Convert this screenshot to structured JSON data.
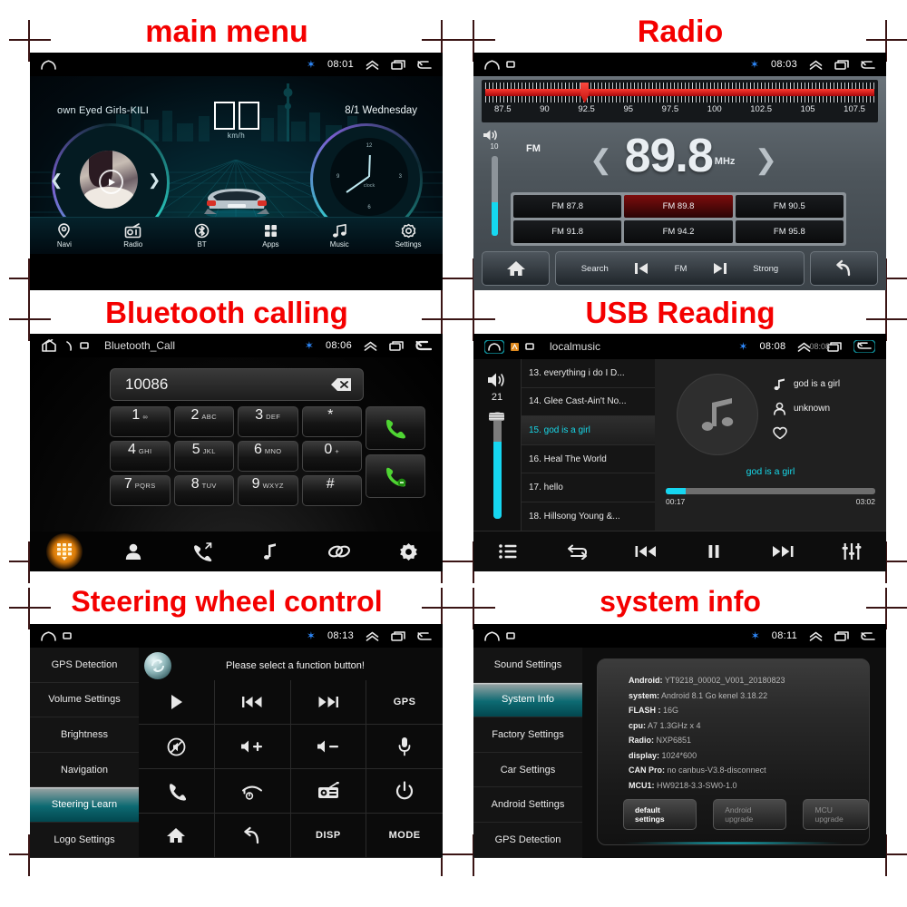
{
  "captions": {
    "main_menu": "main menu",
    "radio": "Radio",
    "bluetooth": "Bluetooth calling",
    "usb": "USB Reading",
    "steering": "Steering wheel control",
    "system": "system info"
  },
  "main_menu": {
    "statusbar": {
      "clock": "08:01",
      "bluetooth_icon": "bluetooth-icon"
    },
    "track_title": "own Eyed Girls-KILI",
    "date": "8/1  Wednesday",
    "speed_unit": "km/h",
    "clock_label": "clock",
    "clock_numbers": [
      "12",
      "3",
      "6",
      "9"
    ],
    "nav": [
      {
        "label": "Navi",
        "icon": "location-pin-icon"
      },
      {
        "label": "Radio",
        "icon": "radio-icon"
      },
      {
        "label": "BT",
        "icon": "bluetooth-icon"
      },
      {
        "label": "Apps",
        "icon": "grid-apps-icon"
      },
      {
        "label": "Music",
        "icon": "music-note-icon"
      },
      {
        "label": "Settings",
        "icon": "gear-icon"
      }
    ]
  },
  "radio": {
    "statusbar": {
      "clock": "08:03"
    },
    "scale_labels": [
      "87.5",
      "90",
      "92.5",
      "95",
      "97.5",
      "100",
      "102.5",
      "105",
      "107.5"
    ],
    "volume": "10",
    "band": "FM",
    "frequency": "89.8",
    "unit": "MHz",
    "presets": [
      {
        "label": "FM 87.8",
        "active": false
      },
      {
        "label": "FM 89.8",
        "active": true
      },
      {
        "label": "FM 90.5",
        "active": false
      },
      {
        "label": "FM 91.8",
        "active": false
      },
      {
        "label": "FM 94.2",
        "active": false
      },
      {
        "label": "FM 95.8",
        "active": false
      }
    ],
    "bottom": {
      "home_icon": "home-icon",
      "search": "Search",
      "prev_icon": "skip-previous-icon",
      "band": "FM",
      "next_icon": "skip-next-icon",
      "strong": "Strong",
      "back_icon": "back-arrow-icon"
    }
  },
  "bluetooth": {
    "statusbar": {
      "clock": "08:06",
      "title": "Bluetooth_Call"
    },
    "number": "10086",
    "delete_icon": "backspace-icon",
    "keys": [
      {
        "digit": "1",
        "sub": "∞"
      },
      {
        "digit": "2",
        "sub": "ABC"
      },
      {
        "digit": "3",
        "sub": "DEF"
      },
      {
        "digit": "*",
        "sub": ""
      },
      {
        "digit": "4",
        "sub": "GHI"
      },
      {
        "digit": "5",
        "sub": "JKL"
      },
      {
        "digit": "6",
        "sub": "MNO"
      },
      {
        "digit": "0",
        "sub": "+"
      },
      {
        "digit": "7",
        "sub": "PQRS"
      },
      {
        "digit": "8",
        "sub": "TUV"
      },
      {
        "digit": "9",
        "sub": "WXYZ"
      },
      {
        "digit": "#",
        "sub": ""
      }
    ],
    "call_icon": "call-green-icon",
    "hangup_icon": "call-end-green-icon",
    "dock": [
      "dialpad-icon",
      "contacts-icon",
      "call-history-icon",
      "music-note-icon",
      "link-pair-icon",
      "gear-icon"
    ]
  },
  "usb": {
    "statusbar": {
      "clock": "08:08",
      "title": "localmusic",
      "ghost_clock": "08:08"
    },
    "volume": "21",
    "tracks": [
      {
        "label": "13. everything i do I D...",
        "current": false
      },
      {
        "label": "14. Glee Cast-Ain't No...",
        "current": false
      },
      {
        "label": "15. god is a girl",
        "current": true
      },
      {
        "label": "16. Heal The World",
        "current": false
      },
      {
        "label": "17. hello",
        "current": false
      },
      {
        "label": "18. Hillsong Young &...",
        "current": false
      }
    ],
    "song_title": "god is a girl",
    "artist": "unknown",
    "favorite_icon": "heart-icon",
    "now_playing": "god is a girl",
    "elapsed": "00:17",
    "duration": "03:02",
    "dock": [
      "playlist-icon",
      "repeat-icon",
      "skip-previous-icon",
      "pause-icon",
      "skip-next-icon",
      "equalizer-icon"
    ]
  },
  "steering": {
    "statusbar": {
      "clock": "08:13"
    },
    "menu": [
      {
        "label": "GPS Detection",
        "active": false
      },
      {
        "label": "Volume Settings",
        "active": false
      },
      {
        "label": "Brightness",
        "active": false
      },
      {
        "label": "Navigation",
        "active": false
      },
      {
        "label": "Steering Learn",
        "active": true
      },
      {
        "label": "Logo Settings",
        "active": false
      }
    ],
    "refresh_icon": "refresh-circle-icon",
    "message": "Please select a function button!",
    "functions": [
      {
        "icon": "play-icon",
        "text": ""
      },
      {
        "icon": "skip-previous-icon",
        "text": ""
      },
      {
        "icon": "skip-next-icon",
        "text": ""
      },
      {
        "icon": "gps-text-icon",
        "text": "GPS"
      },
      {
        "icon": "mute-icon",
        "text": ""
      },
      {
        "icon": "volume-up-icon",
        "text": ""
      },
      {
        "icon": "volume-down-icon",
        "text": ""
      },
      {
        "icon": "microphone-icon",
        "text": ""
      },
      {
        "icon": "call-icon",
        "text": ""
      },
      {
        "icon": "call-end-icon",
        "text": ""
      },
      {
        "icon": "radio-icon",
        "text": ""
      },
      {
        "icon": "power-icon",
        "text": ""
      },
      {
        "icon": "home-icon",
        "text": ""
      },
      {
        "icon": "back-arrow-icon",
        "text": ""
      },
      {
        "icon": "disp-text-icon",
        "text": "DISP"
      },
      {
        "icon": "mode-text-icon",
        "text": "MODE"
      }
    ]
  },
  "system": {
    "statusbar": {
      "clock": "08:11"
    },
    "menu": [
      {
        "label": "Sound Settings",
        "active": false
      },
      {
        "label": "System Info",
        "active": true
      },
      {
        "label": "Factory Settings",
        "active": false
      },
      {
        "label": "Car Settings",
        "active": false
      },
      {
        "label": "Android Settings",
        "active": false
      },
      {
        "label": "GPS Detection",
        "active": false
      }
    ],
    "info": [
      {
        "key": "Android:",
        "value": "YT9218_00002_V001_20180823"
      },
      {
        "key": "system:",
        "value": "Android 8.1 Go     kenel  3.18.22"
      },
      {
        "key": "FLASH :",
        "value": "16G"
      },
      {
        "key": "cpu:",
        "value": "A7 1.3GHz x 4"
      },
      {
        "key": "Radio:",
        "value": "NXP6851"
      },
      {
        "key": "display:",
        "value": "1024*600"
      },
      {
        "key": "CAN Pro:",
        "value": "no canbus-V3.8-disconnect"
      },
      {
        "key": "MCU1:",
        "value": "HW9218-3.3-SW0-1.0"
      }
    ],
    "buttons": [
      {
        "label": "default settings",
        "primary": true
      },
      {
        "label": "Android upgrade",
        "primary": false
      },
      {
        "label": "MCU upgrade",
        "primary": false
      }
    ]
  },
  "colors": {
    "caption_red": "#f40000",
    "accent_cyan": "#16d6f0",
    "radio_red": "#ff3b30",
    "teal_highlight": "#0d6a72"
  }
}
